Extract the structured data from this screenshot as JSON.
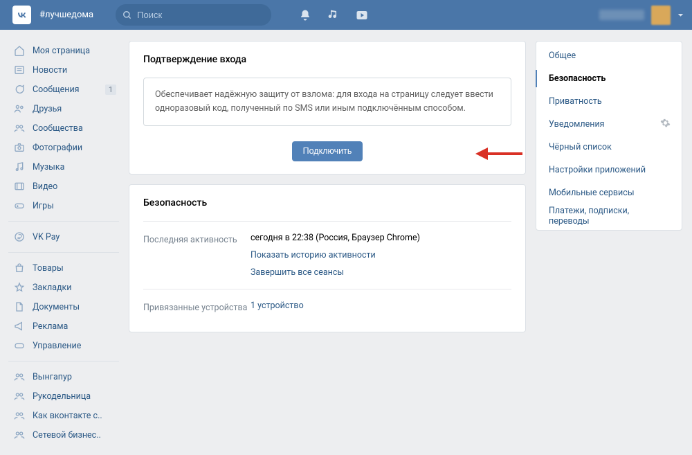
{
  "header": {
    "tag": "#лучшедома",
    "search_placeholder": "Поиск"
  },
  "sidebar": {
    "a": [
      {
        "label": "Моя страница"
      },
      {
        "label": "Новости"
      },
      {
        "label": "Сообщения",
        "badge": "1"
      },
      {
        "label": "Друзья"
      },
      {
        "label": "Сообщества"
      },
      {
        "label": "Фотографии"
      },
      {
        "label": "Музыка"
      },
      {
        "label": "Видео"
      },
      {
        "label": "Игры"
      }
    ],
    "b": [
      {
        "label": "VK Pay"
      }
    ],
    "c": [
      {
        "label": "Товары"
      },
      {
        "label": "Закладки"
      },
      {
        "label": "Документы"
      },
      {
        "label": "Реклама"
      },
      {
        "label": "Управление"
      }
    ],
    "d": [
      {
        "label": "Вынгапур"
      },
      {
        "label": "Рукодельница"
      },
      {
        "label": "Как вконтакте с.."
      },
      {
        "label": "Сетевой бизнес.."
      }
    ]
  },
  "twofa": {
    "title": "Подтверждение входа",
    "notice": "Обеспечивает надёжную защиту от взлома: для входа на страницу следует ввести одноразовый код, полученный по SMS или иным подключённым способом.",
    "connect_label": "Подключить"
  },
  "security": {
    "title": "Безопасность",
    "activity_label": "Последняя активность",
    "activity_value": "сегодня в 22:38 (Россия, Браузер Chrome)",
    "show_history": "Показать историю активности",
    "end_sessions": "Завершить все сеансы",
    "devices_label": "Привязанные устройства",
    "devices_value": "1 устройство"
  },
  "settings_tabs": {
    "items": [
      "Общее",
      "Безопасность",
      "Приватность",
      "Уведомления",
      "Чёрный список",
      "Настройки приложений",
      "Мобильные сервисы",
      "Платежи, подписки, переводы"
    ],
    "active": 1,
    "gear_index": 3
  }
}
